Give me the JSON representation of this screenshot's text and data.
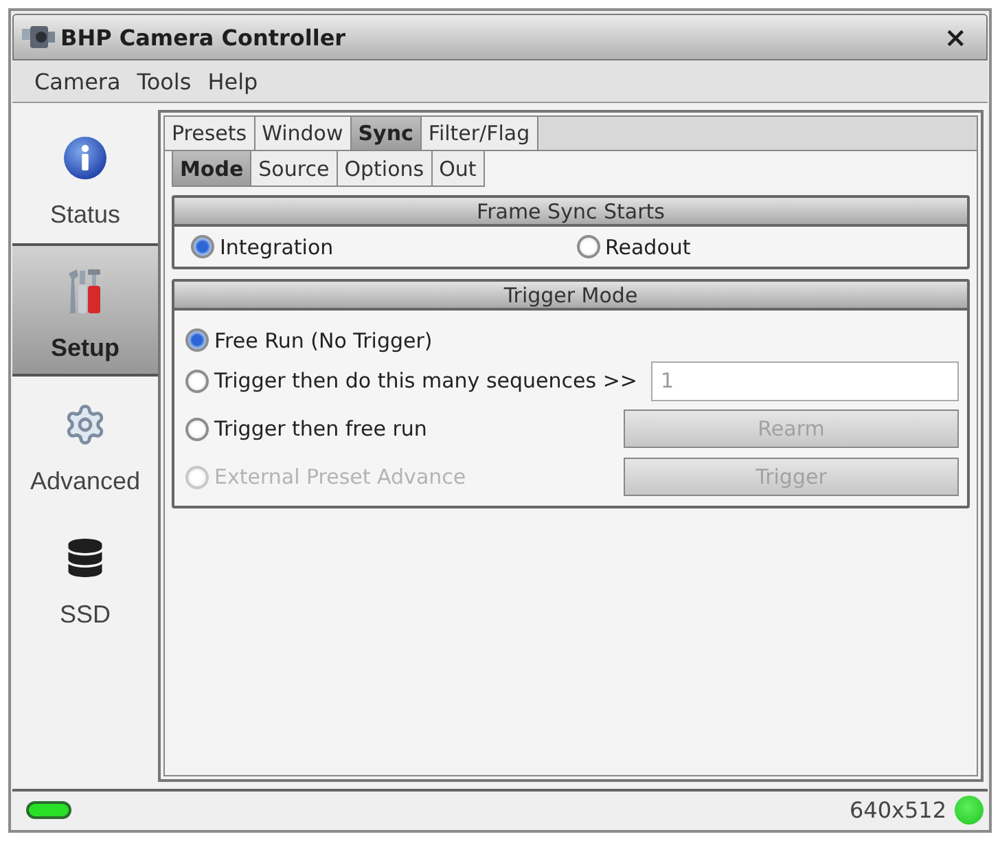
{
  "window": {
    "title": "BHP Camera Controller",
    "close": "×"
  },
  "menu": [
    {
      "label": "Camera"
    },
    {
      "label": "Tools"
    },
    {
      "label": "Help"
    }
  ],
  "sidebar": {
    "items": [
      {
        "kind": "info",
        "label": "Status",
        "selected": false
      },
      {
        "kind": "tools",
        "label": "Setup",
        "selected": true
      },
      {
        "kind": "gear",
        "label": "Advanced",
        "selected": false
      },
      {
        "kind": "database",
        "label": "SSD",
        "selected": false
      }
    ]
  },
  "tabs": [
    {
      "label": "Presets",
      "selected": false
    },
    {
      "label": "Window",
      "selected": false
    },
    {
      "label": "Sync",
      "selected": true
    },
    {
      "label": "Filter/Flag",
      "selected": false
    }
  ],
  "subtabs": [
    {
      "label": "Mode",
      "selected": true
    },
    {
      "label": "Source",
      "selected": false
    },
    {
      "label": "Options",
      "selected": false
    },
    {
      "label": "Out",
      "selected": false
    }
  ],
  "frame_sync": {
    "title": "Frame Sync Starts",
    "options": [
      {
        "label": "Integration",
        "selected": true
      },
      {
        "label": "Readout",
        "selected": false
      }
    ]
  },
  "trigger_mode": {
    "title": "Trigger Mode",
    "options": [
      {
        "label": "Free Run (No Trigger)",
        "selected": true,
        "disabled": false
      },
      {
        "label": "Trigger then do this many sequences >>",
        "selected": false,
        "disabled": false,
        "field": {
          "value": "1"
        }
      },
      {
        "label": "Trigger then free run",
        "selected": false,
        "disabled": false,
        "button": {
          "label": "Rearm",
          "disabled": true
        }
      },
      {
        "label": "External Preset Advance",
        "selected": false,
        "disabled": true,
        "button": {
          "label": "Trigger",
          "disabled": true
        }
      }
    ]
  },
  "status_bar": {
    "resolution": "640x512"
  }
}
